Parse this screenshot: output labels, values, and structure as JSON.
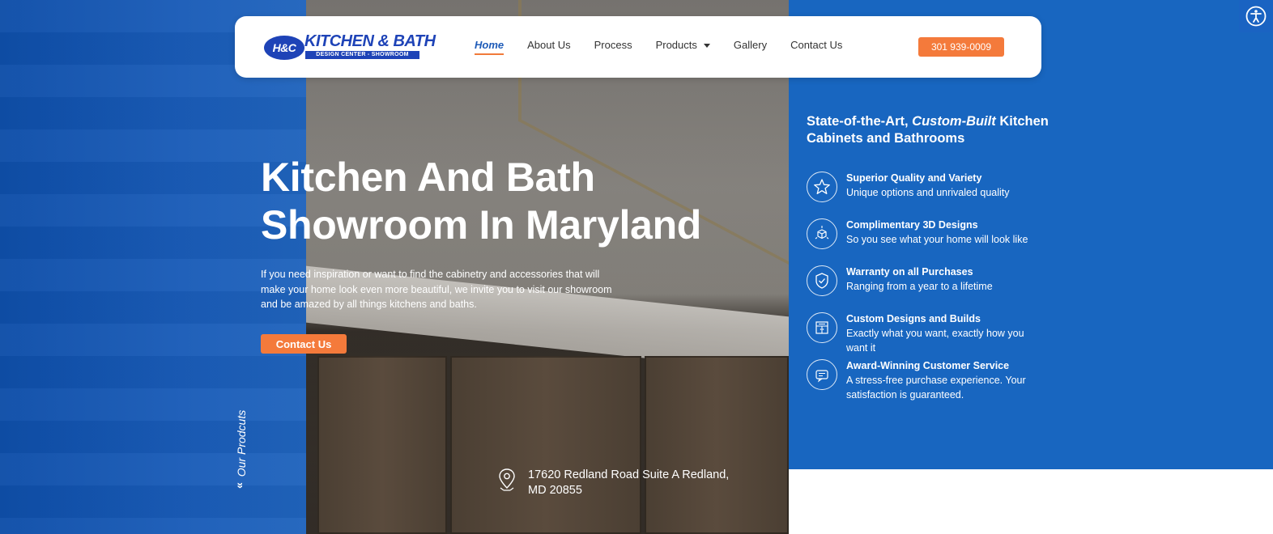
{
  "logo": {
    "badge": "H&C",
    "main": "KITCHEN & BATH",
    "sub": "DESIGN CENTER - SHOWROOM"
  },
  "nav": {
    "items": [
      {
        "label": "Home",
        "active": true
      },
      {
        "label": "About Us"
      },
      {
        "label": "Process"
      },
      {
        "label": "Products",
        "dropdown": true
      },
      {
        "label": "Gallery"
      },
      {
        "label": "Contact Us"
      }
    ],
    "phone": "301 939-0009"
  },
  "hero": {
    "title_line1": "Kitchen And Bath",
    "title_line2": "Showroom In Maryland",
    "text": "If you need inspiration or want to find the cabinetry and accessories that will make your home look even more beautiful, we invite you to visit our showroom and be amazed by all things kitchens and baths.",
    "cta": "Contact Us"
  },
  "side_link": {
    "label": "Our Prodcuts",
    "chevron": "«"
  },
  "address": {
    "line1": "17620 Redland Road Suite A Redland,",
    "line2": "MD 20855"
  },
  "right": {
    "title_pre": "State-of-the-Art, ",
    "title_em": "Custom-Built",
    "title_post": " Kitchen Cabinets and Bathrooms",
    "features": [
      {
        "title": "Superior Quality and Variety",
        "desc": "Unique options and unrivaled quality",
        "icon": "star-icon"
      },
      {
        "title": "Complimentary 3D Designs",
        "desc": "So you see what your home will look like",
        "icon": "cube-3d-icon"
      },
      {
        "title": "Warranty on all Purchases",
        "desc": "Ranging from a year to a lifetime",
        "icon": "shield-check-icon"
      },
      {
        "title": "Custom Designs and Builds",
        "desc": "Exactly what you want, exactly how you want it",
        "icon": "cabinet-icon"
      },
      {
        "title": "Award-Winning Customer Service",
        "desc": "A stress-free purchase experience. Your satisfaction is guaranteed.",
        "icon": "support-icon"
      }
    ]
  },
  "colors": {
    "brand_blue": "#1866c0",
    "accent_orange": "#f47a3b",
    "logo_blue": "#1e43b7"
  }
}
